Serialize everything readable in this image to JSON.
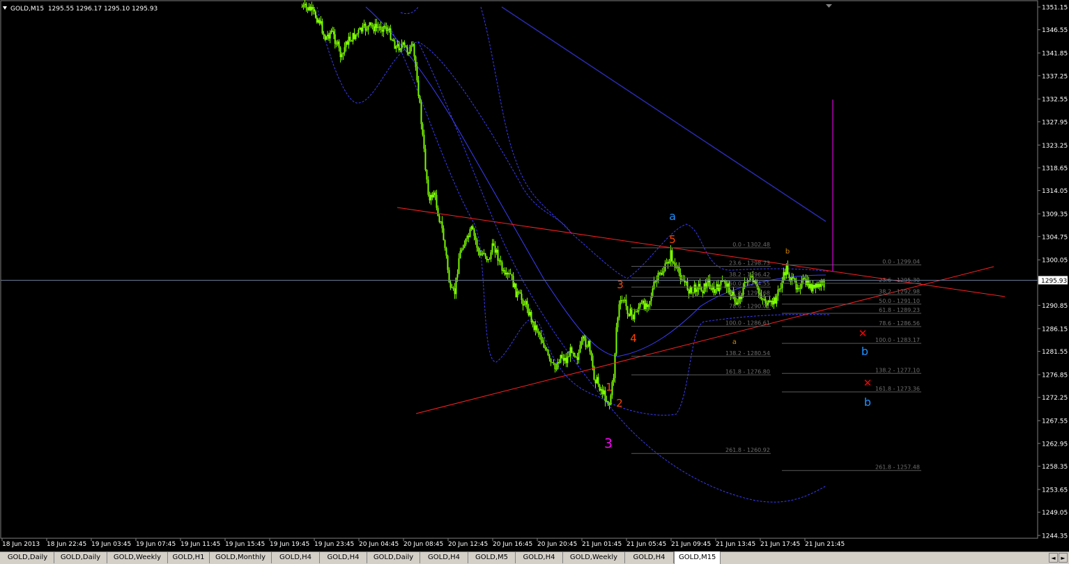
{
  "header": {
    "symbol": "GOLD,M15",
    "prices": "1295.55 1296.17 1295.10 1295.93"
  },
  "price_axis": {
    "labels": [
      "1351.15",
      "1346.55",
      "1341.85",
      "1337.25",
      "1332.55",
      "1327.95",
      "1323.25",
      "1318.65",
      "1314.05",
      "1309.35",
      "1304.75",
      "1300.05",
      "1290.85",
      "1286.15",
      "1281.55",
      "1276.85",
      "1272.25",
      "1267.55",
      "1262.95",
      "1258.35",
      "1253.65",
      "1249.05",
      "1244.35"
    ],
    "current": "1295.93",
    "current_color": "#ffffff"
  },
  "time_axis": {
    "labels": [
      "18 Jun 2013",
      "18 Jun 22:45",
      "19 Jun 03:45",
      "19 Jun 07:45",
      "19 Jun 11:45",
      "19 Jun 15:45",
      "19 Jun 19:45",
      "19 Jun 23:45",
      "20 Jun 04:45",
      "20 Jun 08:45",
      "20 Jun 12:45",
      "20 Jun 16:45",
      "20 Jun 20:45",
      "21 Jun 01:45",
      "21 Jun 05:45",
      "21 Jun 09:45",
      "21 Jun 13:45",
      "21 Jun 17:45",
      "21 Jun 21:45"
    ]
  },
  "fib_left": [
    "0.0 - 1302.48",
    "23.6 - 1298.73",
    "38.2 - 1296.42",
    "50.0 - 1294.55",
    "61.8 - 1292.68",
    "78.6 - 1290.01",
    "100.0 - 1286.61",
    "138.2 - 1280.54",
    "161.8 - 1276.80",
    "261.8 - 1260.92"
  ],
  "fib_right": [
    "0.0 - 1299.04",
    "23.6 - 1295.30",
    "38.2 - 1292.98",
    "50.0 - 1291.10",
    "61.8 - 1289.23",
    "78.6 - 1286.56",
    "100.0 - 1283.17",
    "138.2 - 1277.10",
    "161.8 - 1273.36",
    "261.8 - 1257.48"
  ],
  "wave_labels": {
    "w1": "1",
    "w2": "2",
    "w3": "3",
    "w4": "4",
    "w5": "5",
    "big3": "3",
    "a_blue": "a",
    "b_blue_1": "b",
    "b_blue_2": "b",
    "a_orange": "a",
    "b_orange": "b",
    "x1": "✕",
    "x2": "✕"
  },
  "colors": {
    "candle": "#7cfc00",
    "trendline": "#ff2020",
    "ma": "#3c3cff",
    "fib": "#5a5a5a",
    "fib_text": "#6e6e6e",
    "wave_orange": "#ff4500",
    "wave_magenta": "#ff00ff",
    "wave_blue": "#1e90ff",
    "wave_tan": "#cd8500",
    "marker": "#ff0000"
  },
  "tabs": [
    "GOLD,Daily",
    "GOLD,Daily",
    "GOLD,Weekly",
    "GOLD,H1",
    "GOLD,Monthly",
    "GOLD,H4",
    "GOLD,H4",
    "GOLD,Daily",
    "GOLD,H4",
    "GOLD,M5",
    "GOLD,H4",
    "GOLD,Weekly",
    "GOLD,H4",
    "GOLD,M15"
  ],
  "tab_scroll": {
    "left": "◄",
    "right": "►"
  }
}
